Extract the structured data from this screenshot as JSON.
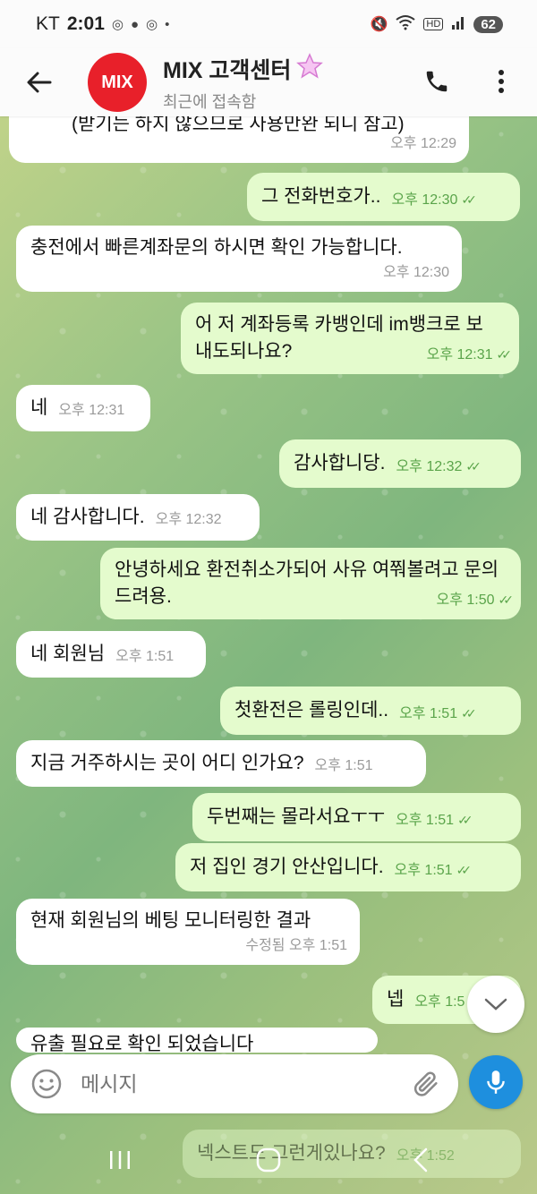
{
  "status_bar": {
    "carrier": "KT",
    "time": "2:01",
    "battery": "62"
  },
  "header": {
    "avatar_text": "MIX",
    "title": "MIX 고객센터",
    "subtitle": "최근에 접속함"
  },
  "messages": [
    {
      "dir": "in",
      "text": "(받기는 하지 않으므로 사용만완 되니 참고)",
      "time": "오후 12:29"
    },
    {
      "dir": "out",
      "text": "그 전화번호가..",
      "time": "오후 12:30"
    },
    {
      "dir": "in",
      "text": "충전에서 빠른계좌문의 하시면 확인 가능합니다.",
      "time": "오후 12:30"
    },
    {
      "dir": "out",
      "text": "어 저 계좌등록 카뱅인데  im뱅크로 보내도되나요?",
      "time": "오후 12:31"
    },
    {
      "dir": "in",
      "text": "네",
      "time": "오후 12:31"
    },
    {
      "dir": "out",
      "text": "감사합니당.",
      "time": "오후 12:32"
    },
    {
      "dir": "in",
      "text": "네 감사합니다.",
      "time": "오후 12:32"
    },
    {
      "dir": "out",
      "text": "안녕하세요 환전취소가되어 사유 여쭤볼려고 문의드려용.",
      "time": "오후 1:50"
    },
    {
      "dir": "in",
      "text": "네 회원님",
      "time": "오후 1:51"
    },
    {
      "dir": "out",
      "text": "첫환전은 롤링인데..",
      "time": "오후 1:51"
    },
    {
      "dir": "in",
      "text": "지금 거주하시는 곳이 어디 인가요?",
      "time": "오후 1:51"
    },
    {
      "dir": "out",
      "text": "두번째는 몰라서요ㅜㅜ",
      "time": "오후 1:51"
    },
    {
      "dir": "out",
      "text": "저 집인 경기 안산입니다.",
      "time": "오후 1:51"
    },
    {
      "dir": "in",
      "text": "현재 회원님의 베팅 모니터링한 결과",
      "time": "수정됨 오후 1:51"
    },
    {
      "dir": "out",
      "text": "넵",
      "time": "오후 1:5"
    },
    {
      "dir": "in",
      "text": "유출 필요로 확인 되었습니다",
      "time": ""
    },
    {
      "dir": "out",
      "text": "넥스트도 그런게있나요?",
      "time": "오후 1:52"
    }
  ],
  "composer": {
    "placeholder": "메시지"
  },
  "colors": {
    "incoming_bubble": "#ffffff",
    "outgoing_bubble": "#e4fbcd",
    "accent_blue": "#1e8fde",
    "avatar_red": "#e8202a",
    "read_check_green": "#5aa44a"
  },
  "icons": [
    "back-arrow-icon",
    "phone-icon",
    "more-vertical-icon",
    "star-emoji-icon",
    "emoji-icon",
    "attach-icon",
    "mic-icon",
    "chevron-down-icon",
    "nav-recents-icon",
    "nav-home-icon",
    "nav-back-icon"
  ]
}
